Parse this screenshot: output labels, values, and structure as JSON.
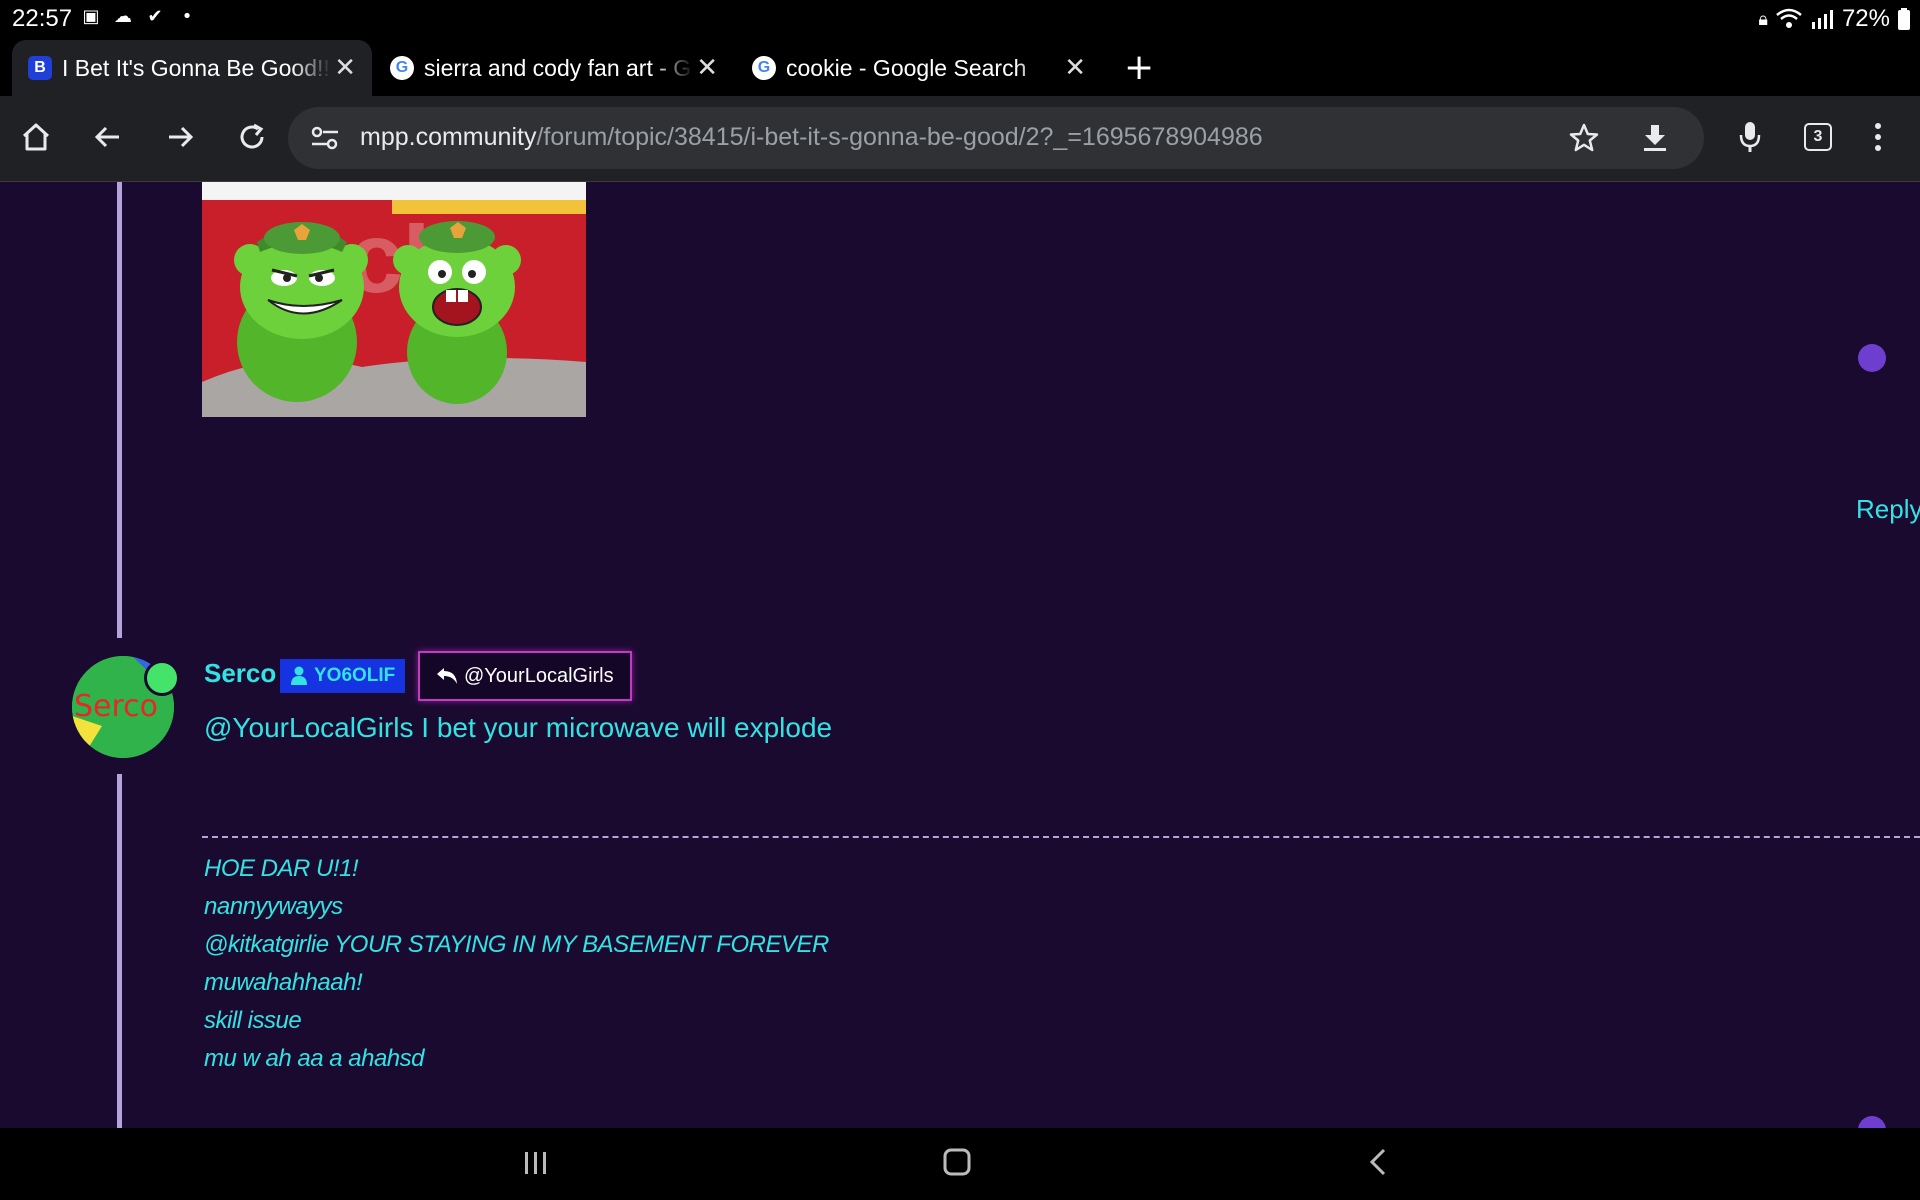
{
  "status_bar": {
    "time": "22:57",
    "battery": "72%"
  },
  "tabs": [
    {
      "favicon_letter": "B",
      "title": "I Bet It's Gonna Be Good!!",
      "active": true
    },
    {
      "favicon_letter": "G",
      "title": "sierra and cody fan art - G",
      "active": false
    },
    {
      "favicon_letter": "G",
      "title": "cookie - Google Search",
      "active": false
    }
  ],
  "omnibox": {
    "host": "mpp.community",
    "path": "/forum/topic/38415/i-bet-it-s-gonna-be-good/2?_=1695678904986"
  },
  "tab_count": "3",
  "post1": {
    "reply_label": "Reply"
  },
  "post2": {
    "avatar_text": "Serco",
    "username": "Serco",
    "badge": "YO6OLIF",
    "reply_to": "@YourLocalGirls",
    "message": "@YourLocalGirls I bet your microwave will explode",
    "signature": [
      "HOE DAR U!1!",
      "nannyywayys",
      "@kitkatgirlie YOUR STAYING IN MY BASEMENT FOREVER",
      "muwahahhaah!",
      "skill issue",
      "mu w ah aa a ahahsd"
    ]
  },
  "colors": {
    "page_bg": "#1b0a30",
    "accent_cyan": "#33e3e3",
    "badge_blue": "#1533e0",
    "thread_line": "#b7a3dc"
  }
}
